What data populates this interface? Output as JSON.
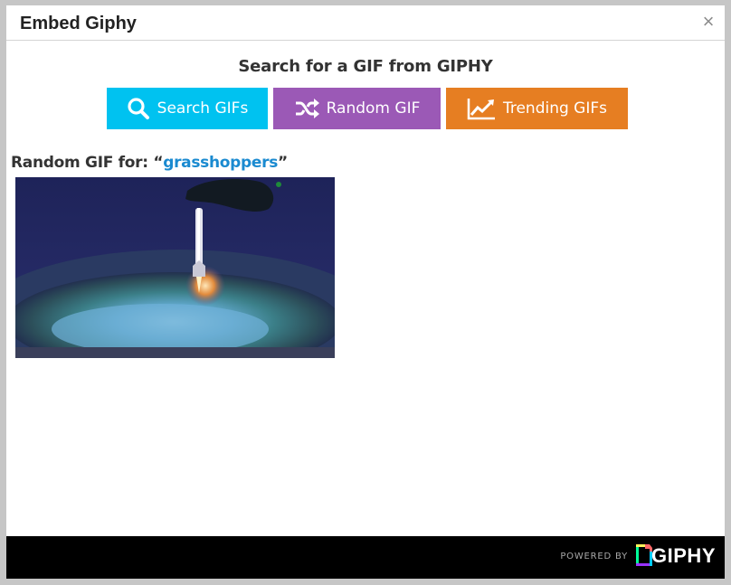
{
  "modal": {
    "title": "Embed Giphy",
    "close_glyph": "×"
  },
  "search": {
    "heading": "Search for a GIF from GIPHY"
  },
  "buttons": [
    {
      "label": "Search GIFs",
      "icon": "search-icon",
      "color": "#00c2f0"
    },
    {
      "label": "Random GIF",
      "icon": "shuffle-icon",
      "color": "#9b59b6"
    },
    {
      "label": "Trending GIFs",
      "icon": "trending-chart-icon",
      "color": "#e67e22"
    }
  ],
  "result": {
    "prefix": "Random GIF for: “",
    "term": "grasshoppers",
    "suffix": "”"
  },
  "footer": {
    "powered_by": "POWERED BY",
    "brand": "GIPHY"
  }
}
